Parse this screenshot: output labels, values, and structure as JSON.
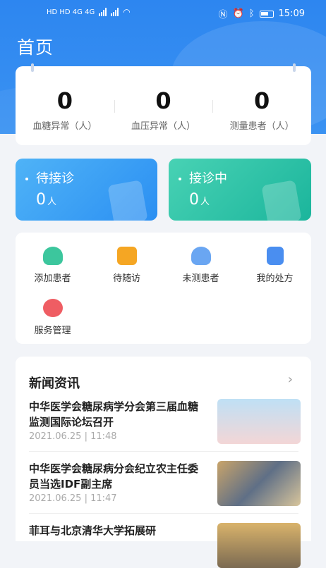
{
  "status": {
    "time": "15:09",
    "left": "HD HD 4G 4G",
    "icons": [
      "nfc-icon",
      "alarm-icon",
      "bluetooth-icon",
      "battery-icon"
    ]
  },
  "page": {
    "title": "首页"
  },
  "stats": [
    {
      "value": "0",
      "label": "血糖异常（人）"
    },
    {
      "value": "0",
      "label": "血压异常（人）"
    },
    {
      "value": "0",
      "label": "测量患者（人）"
    }
  ],
  "consult": [
    {
      "label": "待接诊",
      "value": "0",
      "unit": "人",
      "color": "#2b8ff2"
    },
    {
      "label": "接诊中",
      "value": "0",
      "unit": "人",
      "color": "#1bb59c"
    }
  ],
  "shortcuts": [
    {
      "label": "添加患者",
      "icon": "add-patient-icon",
      "color": "#3cc69d"
    },
    {
      "label": "待随访",
      "icon": "follow-up-icon",
      "color": "#f5a623"
    },
    {
      "label": "未测患者",
      "icon": "unmeasured-patient-icon",
      "color": "#6aa6f2"
    },
    {
      "label": "我的处方",
      "icon": "prescription-icon",
      "color": "#4a8ef0"
    },
    {
      "label": "服务管理",
      "icon": "service-heart-icon",
      "color": "#ef5d63"
    }
  ],
  "news": {
    "heading": "新闻资讯",
    "more": "›",
    "items": [
      {
        "title": "中华医学会糖尿病学分会第三届血糖监测国际论坛召开",
        "date": "2021.06.25",
        "time": "11:48"
      },
      {
        "title": "中华医学会糖尿病分会纪立农主任委员当选IDF副主席",
        "date": "2021.06.25",
        "time": "11:47"
      },
      {
        "title": "菲耳与北京清华大学拓展研",
        "date": "",
        "time": ""
      }
    ]
  }
}
